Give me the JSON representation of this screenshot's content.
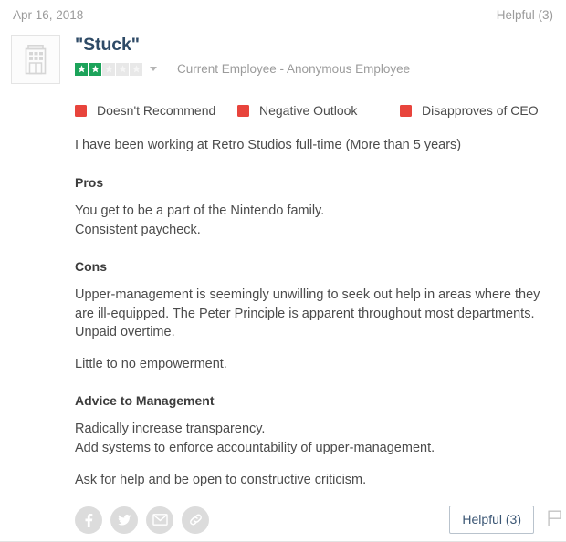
{
  "meta": {
    "date": "Apr 16, 2018",
    "helpful_count_label": "Helpful (3)"
  },
  "header": {
    "logo_icon": "office-building-icon",
    "title": "\"Stuck\"",
    "rating": {
      "value": 2,
      "max": 5,
      "filled_color": "#1ca35a",
      "empty_color": "#e8e8e8",
      "caret_icon": "chevron-down-icon"
    },
    "employee_status": "Current Employee - Anonymous Employee"
  },
  "flags": {
    "swatch_color": "#e8443c",
    "items": [
      {
        "label": "Doesn't Recommend"
      },
      {
        "label": "Negative Outlook"
      },
      {
        "label": "Disapproves of CEO"
      }
    ]
  },
  "summary": "I have been working at Retro Studios full-time (More than 5 years)",
  "sections": [
    {
      "heading": "Pros",
      "paragraphs": [
        "You get to be a part of the Nintendo family.\nConsistent paycheck."
      ]
    },
    {
      "heading": "Cons",
      "paragraphs": [
        "Upper-management is seemingly unwilling to seek out help in areas where they are ill-equipped. The Peter Principle is apparent throughout most departments.\nUnpaid overtime.",
        "Little to no empowerment."
      ]
    },
    {
      "heading": "Advice to Management",
      "paragraphs": [
        "Radically increase transparency.\nAdd systems to enforce accountability of upper-management.",
        "Ask for help and be open to constructive criticism."
      ]
    }
  ],
  "footer": {
    "share": [
      {
        "name": "facebook-icon"
      },
      {
        "name": "twitter-icon"
      },
      {
        "name": "email-icon"
      },
      {
        "name": "link-icon"
      }
    ],
    "helpful_button_label": "Helpful (3)",
    "flag_icon": "flag-icon"
  }
}
